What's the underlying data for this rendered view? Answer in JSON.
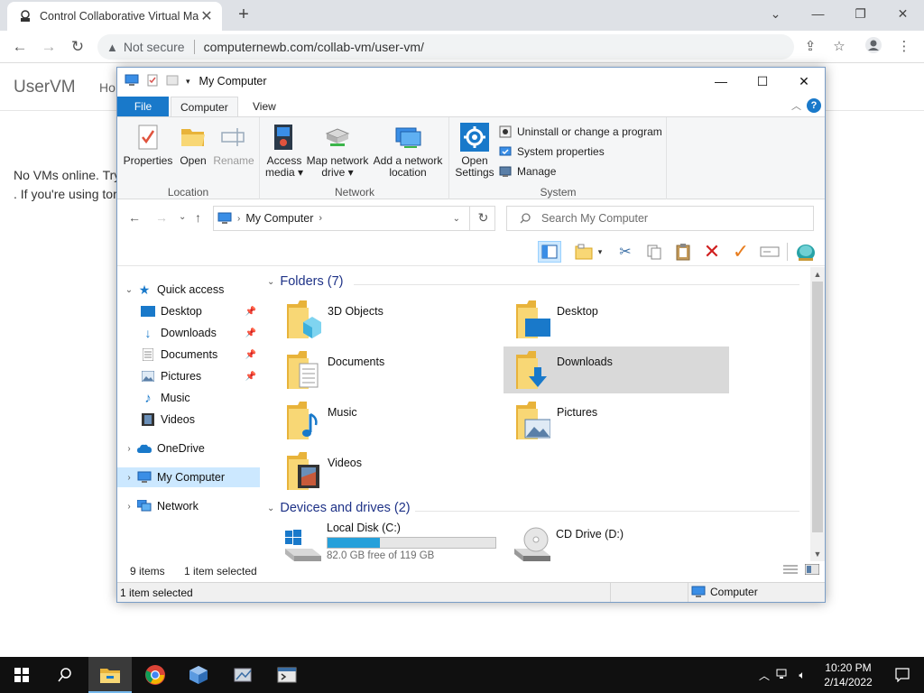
{
  "browser": {
    "tab_title": "Control Collaborative Virtual Ma",
    "new_tab_symbol": "+",
    "address": {
      "security_label": "Not secure",
      "url": "computernewb.com/collab-vm/user-vm/"
    }
  },
  "page": {
    "brand": "UserVM",
    "nav_home": "Ho",
    "line1": "No VMs online. Try",
    "line2": ". If you're using tor"
  },
  "explorer": {
    "title": "My Computer",
    "ribbon_tabs": [
      "File",
      "Computer",
      "View"
    ],
    "groups": {
      "location": {
        "label": "Location",
        "buttons": [
          "Properties",
          "Open",
          "Rename"
        ]
      },
      "network": {
        "label": "Network",
        "access_media": [
          "Access",
          "media"
        ],
        "map_drive": [
          "Map network",
          "drive"
        ],
        "add_location": [
          "Add a network",
          "location"
        ]
      },
      "system": {
        "label": "System",
        "open_settings": [
          "Open",
          "Settings"
        ],
        "uninstall": "Uninstall or change a program",
        "sys_props": "System properties",
        "manage": "Manage"
      }
    },
    "address_path": "My Computer",
    "search_placeholder": "Search My Computer",
    "nav": {
      "quick_access": "Quick access",
      "quick_items": [
        "Desktop",
        "Downloads",
        "Documents",
        "Pictures",
        "Music",
        "Videos"
      ],
      "onedrive": "OneDrive",
      "my_computer": "My Computer",
      "network": "Network"
    },
    "folders_header": "Folders (7)",
    "folders": [
      "3D Objects",
      "Desktop",
      "Documents",
      "Downloads",
      "Music",
      "Pictures",
      "Videos"
    ],
    "selected_folder": "Downloads",
    "drives_header": "Devices and drives (2)",
    "drives": [
      {
        "name": "Local Disk (C:)",
        "free": "82.0 GB free of 119 GB",
        "used_fraction": 0.31
      },
      {
        "name": "CD Drive (D:)"
      }
    ],
    "info": {
      "items": "9 items",
      "selected": "1 item selected"
    },
    "status": {
      "left": "1 item selected",
      "right": "Computer"
    }
  },
  "taskbar": {
    "time": "10:20 PM",
    "date": "2/14/2022"
  },
  "colors": {
    "accent": "#1979ca",
    "selection": "#cce8ff",
    "drive_fill": "#26a0da",
    "folder_yellow": "#f8d775"
  }
}
